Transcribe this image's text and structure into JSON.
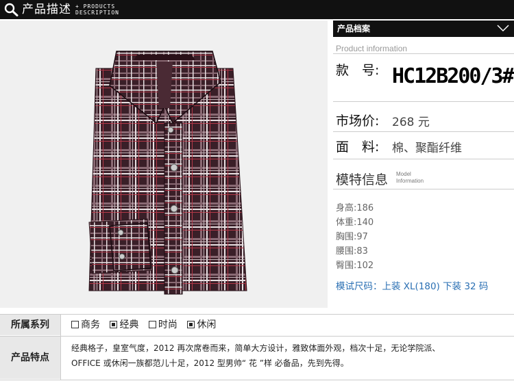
{
  "header": {
    "title": "产品描述",
    "subtitle_line1": "+ PRODUCTS",
    "subtitle_line2": "DESCRIPTION",
    "icon": "search-icon"
  },
  "panel": {
    "title": "产品档案",
    "subtitle_en": "Product information",
    "code_label": "款　号:",
    "code_value": "HC12B200/3#",
    "price_label": "市场价:",
    "price_value": "268 元",
    "material_label": "面　料:",
    "material_value": "棉、聚酯纤维",
    "model_title": "模特信息",
    "model_en_1": "Model",
    "model_en_2": "Information",
    "model_stats": [
      {
        "label": "身高:",
        "value": "186"
      },
      {
        "label": "体重:",
        "value": "140"
      },
      {
        "label": "胸围:",
        "value": "97"
      },
      {
        "label": "腰围:",
        "value": "83"
      },
      {
        "label": "臀围:",
        "value": "102"
      }
    ],
    "size_line": "模试尺码：上装 XL(180) 下装 32 码"
  },
  "series": {
    "label": "所属系列",
    "options": [
      {
        "name": "商务",
        "checked": false
      },
      {
        "name": "经典",
        "checked": true
      },
      {
        "name": "时尚",
        "checked": false
      },
      {
        "name": "休闲",
        "checked": true
      }
    ]
  },
  "features": {
    "label": "产品特点",
    "line1": "经典格子，皇室气度，2012 再次席卷而来，简单大方设计，雅致体面外观，档次十足，无论学院派、",
    "line2": "OFFICE 或休闲一族都范儿十足，2012 型男帅“ 花 ”样  必备品，先到先得。"
  },
  "colors": {
    "header_bg": "#111111",
    "shirt_base": "#3a1f28",
    "size_link": "#2a6fb3"
  }
}
